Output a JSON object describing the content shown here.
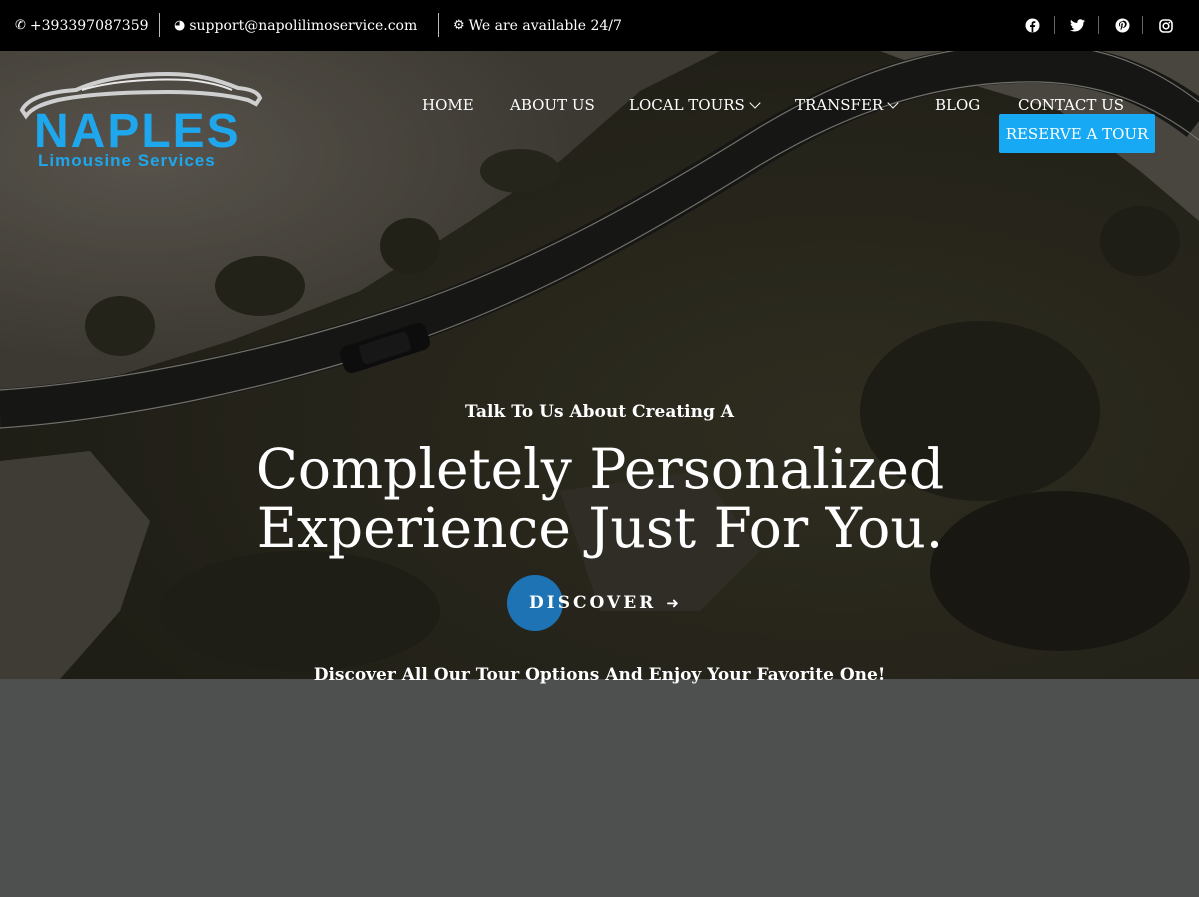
{
  "topbar": {
    "phone": "+393397087359",
    "email": "support@napolilimoservice.com",
    "availability": "We are available 24/7",
    "icons": {
      "phone": "phone-icon",
      "email": "globe-icon",
      "availability": "gear-icon"
    },
    "social": [
      "facebook-icon",
      "twitter-icon",
      "pinterest-icon",
      "instagram-icon"
    ]
  },
  "logo": {
    "name": "Naples",
    "subtitle": "Limousine Services",
    "color": "#1ea7ec"
  },
  "nav": {
    "items": [
      {
        "label": "HOME"
      },
      {
        "label": "ABOUT US"
      },
      {
        "label": "LOCAL TOURS",
        "dropdown": true
      },
      {
        "label": "TRANSFER",
        "dropdown": true
      },
      {
        "label": "BLOG"
      },
      {
        "label": "CONTACT US"
      }
    ],
    "cta": "RESERVE A TOUR",
    "cta_color": "#17a9f3"
  },
  "hero": {
    "kicker": "Talk To Us About Creating A",
    "headline_line1": "Completely Personalized",
    "headline_line2": "Experience Just For You.",
    "button_label": "DISCOVER",
    "button_color": "#1d73b3",
    "tagline": "Discover All Our Tour Options And Enjoy Your Favorite One!"
  },
  "colors": {
    "topbar_bg": "#000000",
    "page_bg": "#4e504f"
  }
}
